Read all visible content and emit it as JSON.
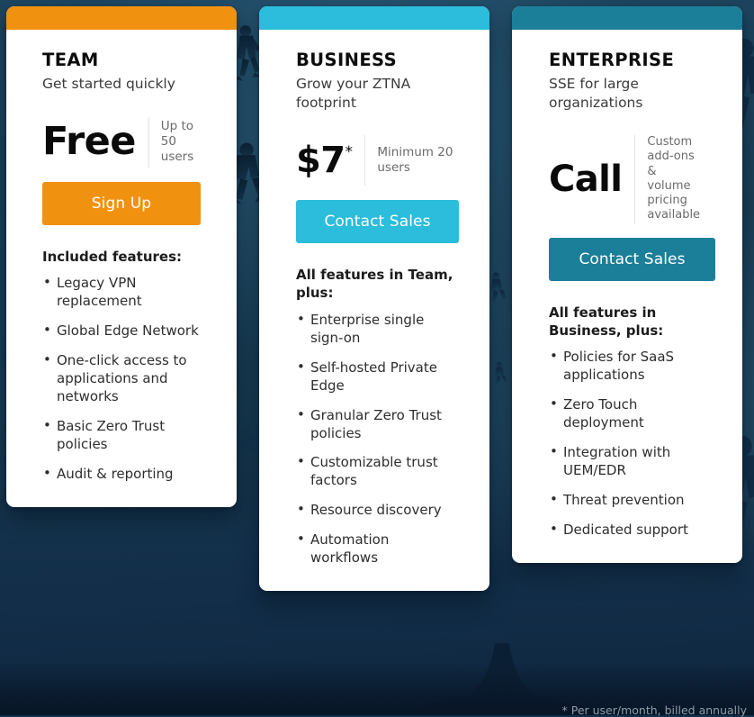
{
  "theme": {
    "team_accent": "#f0920f",
    "business_accent": "#2bbddb",
    "enterprise_accent": "#1c7f99",
    "bg_navy": "#123453",
    "card_bg": "#ffffff",
    "body_text": "#2e2e2e",
    "muted_text": "#6b6b6b"
  },
  "plans": [
    {
      "name": "TEAM",
      "tagline": "Get started quickly",
      "price": "Free",
      "price_sup": "",
      "price_note": "Up to 50 users",
      "price_note_lines": [
        "Up to",
        "50",
        "users"
      ],
      "cta_label": "Sign Up",
      "features_title": "Included features:",
      "features": [
        "Legacy VPN replacement",
        "Global Edge Network",
        "One-click access to applications and networks",
        "Basic Zero Trust policies",
        "Audit & reporting"
      ]
    },
    {
      "name": "BUSINESS",
      "tagline": "Grow your ZTNA footprint",
      "price": "$7",
      "price_sup": "*",
      "price_note": "Minimum 20 users",
      "price_note_lines": [
        "Minimum 20",
        "users"
      ],
      "cta_label": "Contact Sales",
      "features_title": "All features in Team, plus:",
      "features": [
        "Enterprise single sign-on",
        "Self-hosted Private Edge",
        "Granular Zero Trust policies",
        "Customizable trust factors",
        "Resource discovery",
        "Automation workflows"
      ]
    },
    {
      "name": "ENTERPRISE",
      "tagline": "SSE for large organizations",
      "price": "Call",
      "price_sup": "",
      "price_note": "Custom add-ons & volume pricing available",
      "price_note_lines": [
        "Custom",
        "add-ons",
        "&",
        "volume",
        "pricing",
        "available"
      ],
      "cta_label": "Contact Sales",
      "features_title": "All features in Business, plus:",
      "features": [
        "Policies for SaaS applications",
        "Zero Touch deployment",
        "Integration with UEM/EDR",
        "Threat prevention",
        "Dedicated support"
      ]
    }
  ],
  "footnote": "* Per user/month, billed annually"
}
